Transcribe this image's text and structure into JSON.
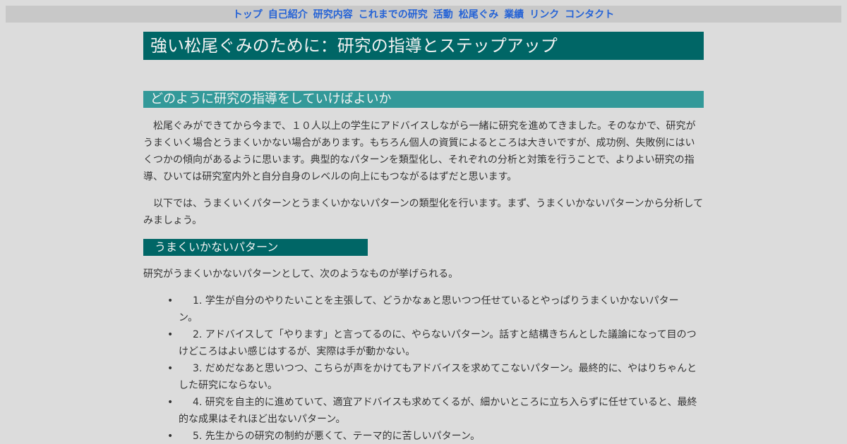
{
  "nav": {
    "items": [
      "トップ",
      "自己紹介",
      "研究内容",
      "これまでの研究",
      "活動",
      "松尾ぐみ",
      "業績",
      "リンク",
      "コンタクト"
    ]
  },
  "page": {
    "title": "強い松尾ぐみのために：研究の指導とステップアップ"
  },
  "section1": {
    "heading": "どのように研究の指導をしていけばよいか",
    "para1": "松尾ぐみができてから今まで、１０人以上の学生にアドバイスしながら一緒に研究を進めてきました。そのなかで、研究がうまくいく場合とうまくいかない場合があります。もちろん個人の資質によるところは大きいですが、成功例、失敗例にはいくつかの傾向があるように思います。典型的なパターンを類型化し、それぞれの分析と対策を行うことで、よりよい研究の指導、ひいては研究室内外と自分自身のレベルの向上にもつながるはずだと思います。",
    "para2": "以下では、うまくいくパターンとうまくいかないパターンの類型化を行います。まず、うまくいかないパターンから分析してみましょう。"
  },
  "section2": {
    "heading": "うまくいかないパターン",
    "intro": "研究がうまくいかないパターンとして、次のようなものが挙げられる。",
    "items": [
      "1. 学生が自分のやりたいことを主張して、どうかなぁと思いつつ任せているとやっぱりうまくいかないパターン。",
      "2. アドバイスして「やります」と言ってるのに、やらないパターン。話すと結構きちんとした議論になって目のつけどころはよい感じはするが、実際は手が動かない。",
      "3. だめだなあと思いつつ、こちらが声をかけてもアドバイスを求めてこないパターン。最終的に、やはりちゃんとした研究にならない。",
      "4. 研究を自主的に進めていて、適宜アドバイスも求めてくるが、細かいところに立ち入らずに任せていると、最終的な成果はそれほど出ないパターン。",
      "5. 先生からの研究の制約が悪くて、テーマ的に苦しいパターン。"
    ]
  },
  "colors": {
    "nav_link": "#2563d6",
    "title_bg": "#006666",
    "heading_bg": "#339999",
    "page_bg": "#dcdcdc"
  }
}
